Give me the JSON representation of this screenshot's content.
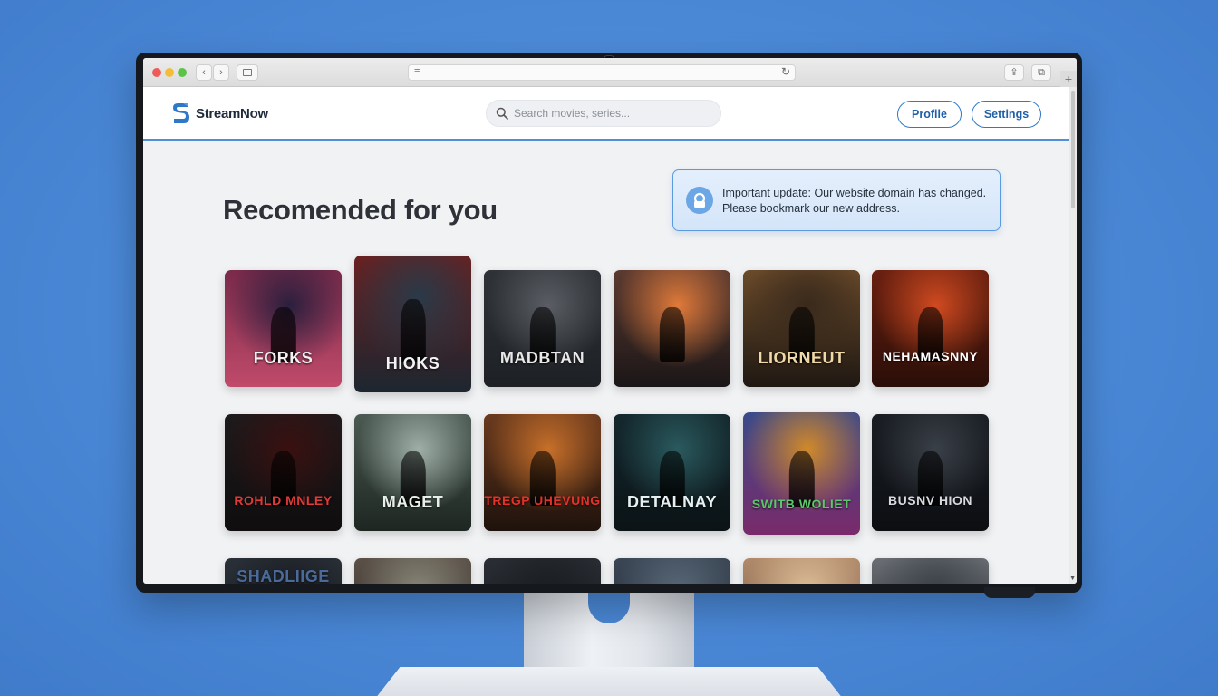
{
  "browser": {
    "url_menu_glyph": "≡",
    "reload_glyph": "↻",
    "back_glyph": "‹",
    "forward_glyph": "›",
    "share_glyph": "⇪",
    "tabs_glyph": "⧉",
    "new_tab_glyph": "+"
  },
  "site": {
    "brand": "StreamNow",
    "accent_color": "#2f78c8",
    "search_placeholder": "Search movies, series...",
    "profile_label": "Profile",
    "settings_label": "Settings"
  },
  "section": {
    "heading": "Recomended for you"
  },
  "notice": {
    "line1": "Important update: Our website domain has changed.",
    "line2": "Please bookmark our new address."
  },
  "movies": [
    {
      "title": "FORKS",
      "bg": [
        "#2a1f3d",
        "#7a2a4a",
        "#c04a6a"
      ],
      "title_color": "#f1f1f1"
    },
    {
      "title": "HIOKS",
      "bg": [
        "#2a3a48",
        "#6a2020",
        "#1d2630"
      ],
      "title_color": "#f3f3f3"
    },
    {
      "title": "MADBTAN",
      "bg": [
        "#5a5e64",
        "#2f3338",
        "#1d2024"
      ],
      "title_color": "#e8e8e8"
    },
    {
      "title": "",
      "bg": [
        "#e07a3a",
        "#5c3a30",
        "#1a1617"
      ],
      "title_color": "#ffffff"
    },
    {
      "title": "LIORNEUT",
      "bg": [
        "#3a2a1c",
        "#6a4a2a",
        "#1f1812"
      ],
      "title_color": "#f0d9a8"
    },
    {
      "title": "NEHAMASNNY",
      "bg": [
        "#d04a20",
        "#6a2010",
        "#2a0e08"
      ],
      "title_color": "#ffffff"
    },
    {
      "title": "ROHLD MNLEY",
      "bg": [
        "#3a1010",
        "#1e1a1c",
        "#0f0d0e"
      ],
      "title_color": "#e03a3a"
    },
    {
      "title": "MAGET",
      "bg": [
        "#a0b0a8",
        "#4a5a52",
        "#1e2622"
      ],
      "title_color": "#e8efe8"
    },
    {
      "title": "TREGP UHEVUNG",
      "bg": [
        "#c8702a",
        "#6a3a1e",
        "#1e120c"
      ],
      "title_color": "#e8302a"
    },
    {
      "title": "DETALNAY",
      "bg": [
        "#2a5a5e",
        "#14282e",
        "#0b1316"
      ],
      "title_color": "#e6f0f2"
    },
    {
      "title": "SWITB WOLIET",
      "bg": [
        "#d08a2a",
        "#3a4a8a",
        "#7a2a6a"
      ],
      "title_color": "#5ac86a"
    },
    {
      "title": "BUSNV HION",
      "bg": [
        "#3a4048",
        "#1a1e24",
        "#0c0e12"
      ],
      "title_color": "#d6d9de"
    },
    {
      "title": "SHADLIIGE",
      "bg": [
        "#1a1d22",
        "#2a3038",
        "#14171b"
      ],
      "title_color": "#4a6a9a"
    },
    {
      "title": "",
      "bg": [
        "#8a8a7a",
        "#5a5048",
        "#2a2420"
      ],
      "title_color": "#ffffff"
    },
    {
      "title": "",
      "bg": [
        "#1a1d22",
        "#2a2e34",
        "#121418"
      ],
      "title_color": "#ffffff"
    },
    {
      "title": "",
      "bg": [
        "#5a6a7a",
        "#3a4654",
        "#1e2430"
      ],
      "title_color": "#ffffff"
    },
    {
      "title": "",
      "bg": [
        "#e0c09a",
        "#b08a6a",
        "#6a4a3a"
      ],
      "title_color": "#3a2a1a"
    },
    {
      "title": "",
      "bg": [
        "#3a4046",
        "#6a6e74",
        "#1e2226"
      ],
      "title_color": "#ffffff"
    }
  ]
}
